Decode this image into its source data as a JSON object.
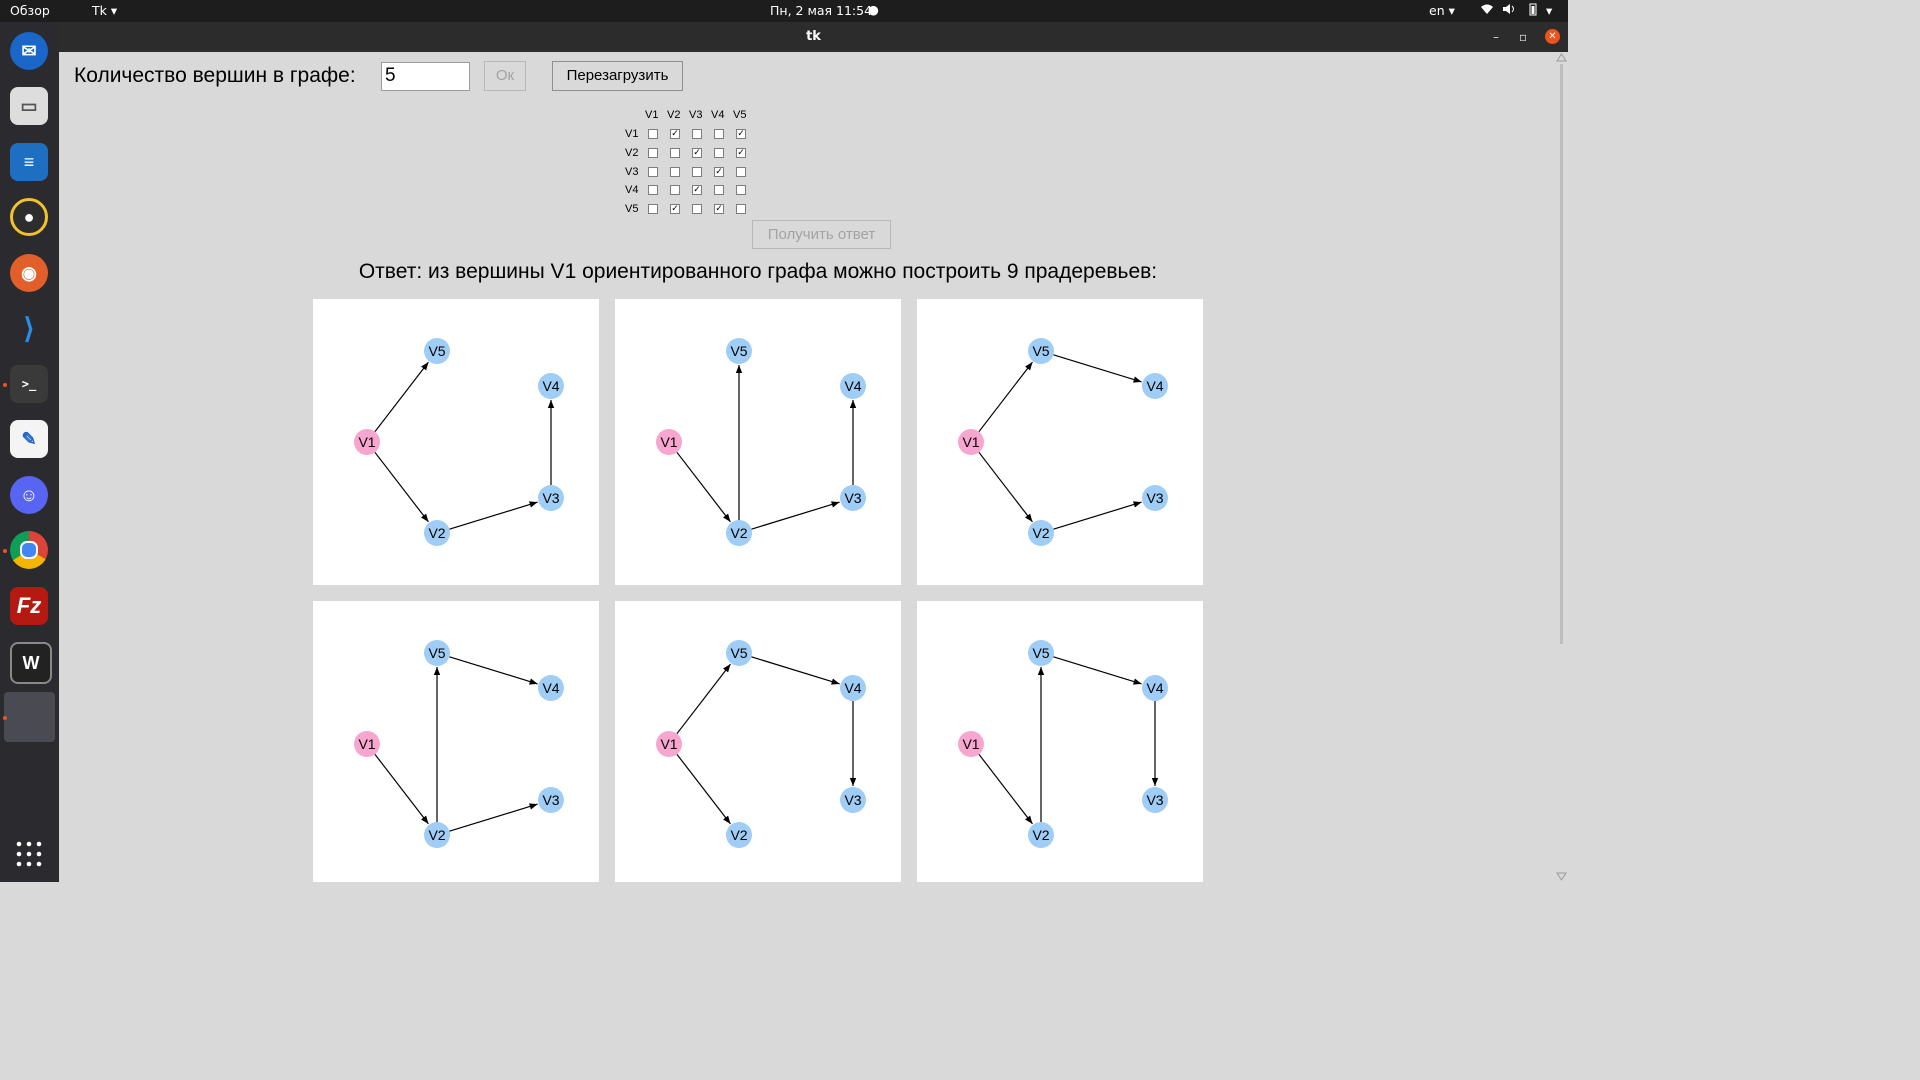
{
  "topbar": {
    "overview": "Обзор",
    "app_menu": "Tk ▾",
    "datetime": "Пн, 2 мая  11:54",
    "lang": "en ▾"
  },
  "window": {
    "title": "tk"
  },
  "form": {
    "vertex_label": "Количество вершин в графе:",
    "vertex_value": "5",
    "ok_label": "Ок",
    "reload_label": "Перезагрузить",
    "get_answer_label": "Получить ответ"
  },
  "matrix": {
    "labels": [
      "V1",
      "V2",
      "V3",
      "V4",
      "V5"
    ],
    "checked": [
      [
        false,
        true,
        false,
        false,
        true
      ],
      [
        false,
        false,
        true,
        false,
        true
      ],
      [
        false,
        false,
        false,
        true,
        false
      ],
      [
        false,
        false,
        true,
        false,
        false
      ],
      [
        false,
        true,
        false,
        true,
        false
      ]
    ]
  },
  "answer": {
    "text": "Ответ: из вершины V1 ориентированного графа можно построить 9 прадеревьев:"
  },
  "graphs": {
    "root": "V1",
    "root_color": "#f7a6cf",
    "node_color": "#9fcdf6",
    "nodes": [
      "V1",
      "V2",
      "V3",
      "V4",
      "V5"
    ],
    "trees": [
      [
        [
          "V1",
          "V5"
        ],
        [
          "V1",
          "V2"
        ],
        [
          "V2",
          "V3"
        ],
        [
          "V3",
          "V4"
        ]
      ],
      [
        [
          "V1",
          "V2"
        ],
        [
          "V2",
          "V5"
        ],
        [
          "V2",
          "V3"
        ],
        [
          "V3",
          "V4"
        ]
      ],
      [
        [
          "V1",
          "V5"
        ],
        [
          "V5",
          "V4"
        ],
        [
          "V1",
          "V2"
        ],
        [
          "V2",
          "V3"
        ]
      ],
      [
        [
          "V1",
          "V2"
        ],
        [
          "V2",
          "V5"
        ],
        [
          "V5",
          "V4"
        ],
        [
          "V2",
          "V3"
        ]
      ],
      [
        [
          "V1",
          "V5"
        ],
        [
          "V5",
          "V4"
        ],
        [
          "V4",
          "V3"
        ],
        [
          "V1",
          "V2"
        ]
      ],
      [
        [
          "V1",
          "V2"
        ],
        [
          "V2",
          "V5"
        ],
        [
          "V5",
          "V4"
        ],
        [
          "V4",
          "V3"
        ]
      ]
    ]
  },
  "dock": {
    "icons": [
      "thunderbird-icon",
      "files-icon",
      "writer-icon",
      "rhythmbox-icon",
      "firefox-icon",
      "vscode-icon",
      "terminal-icon",
      "text-editor-icon",
      "discord-icon",
      "chrome-icon",
      "filezilla-icon",
      "webstorm-icon",
      "tk-app-icon"
    ],
    "apps_grid": "show-applications-icon"
  }
}
